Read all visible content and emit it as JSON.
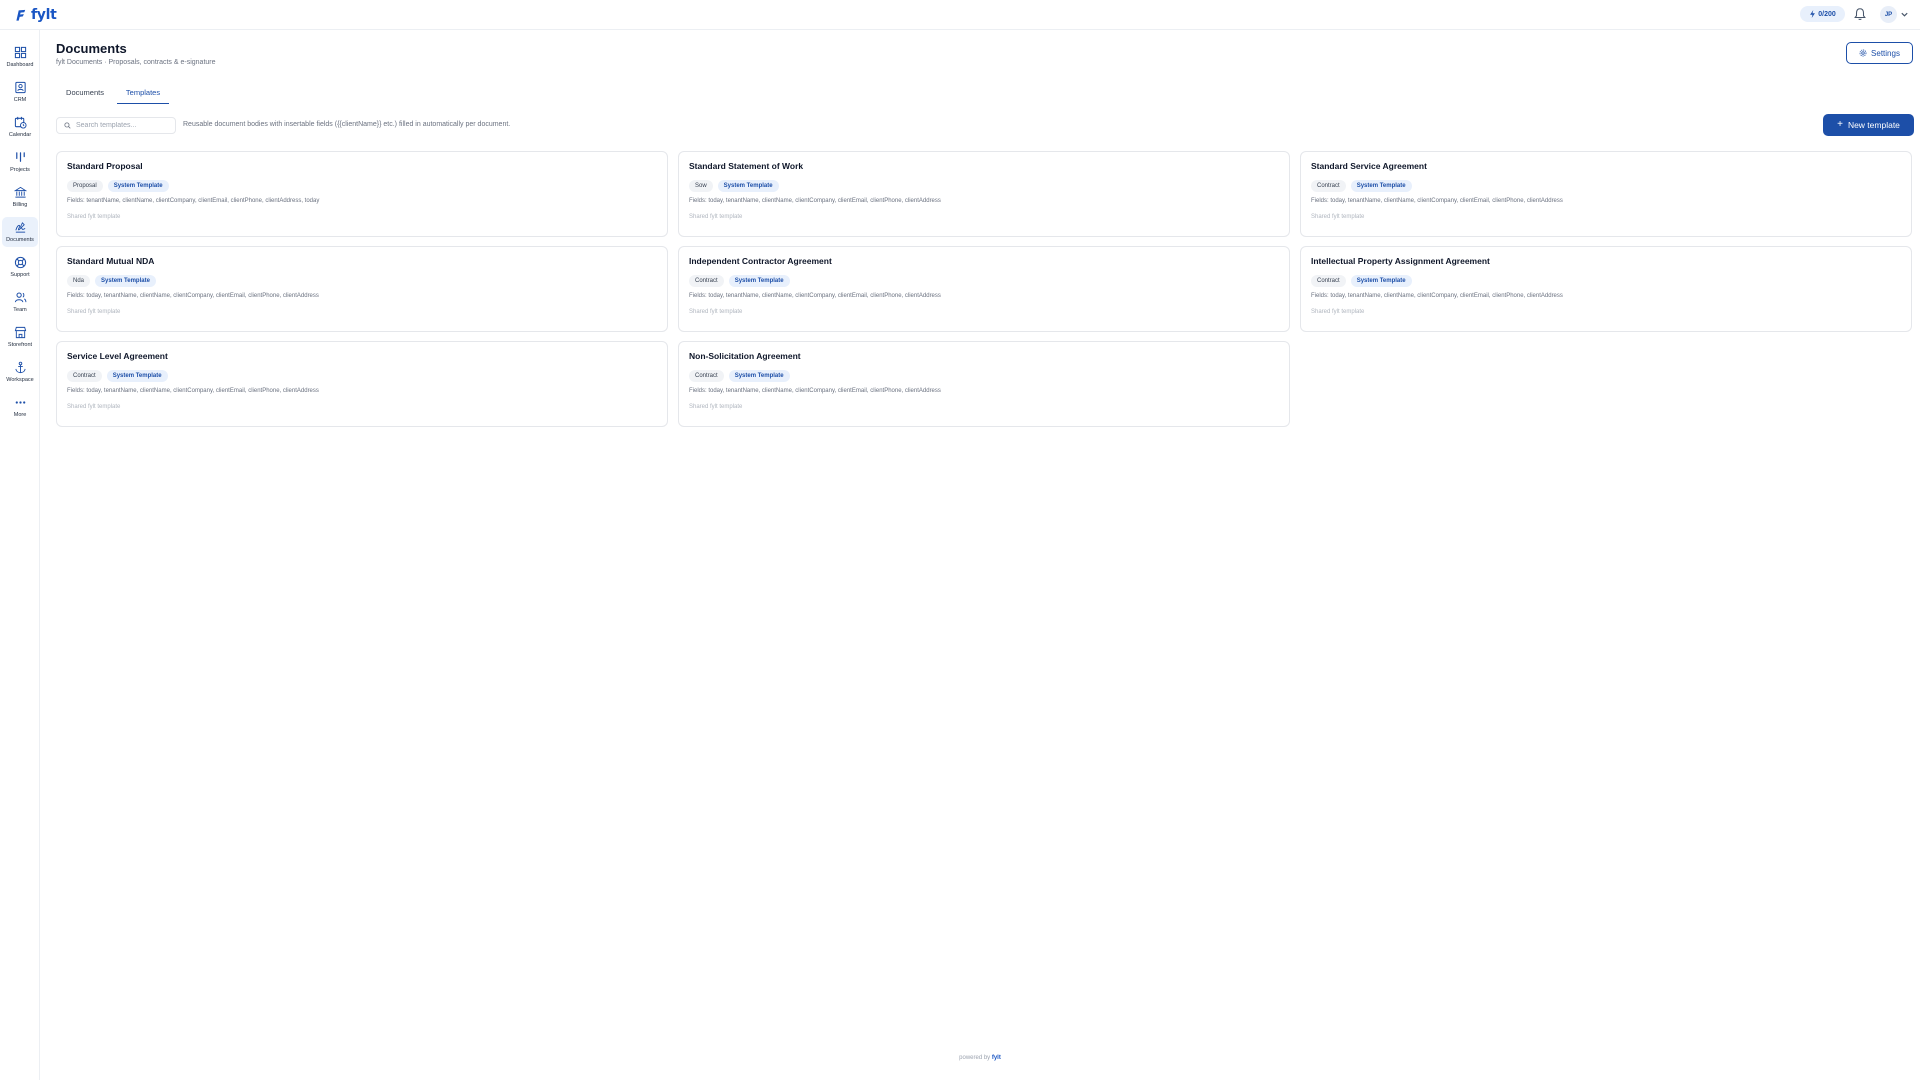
{
  "brand": {
    "name": "fylt"
  },
  "header": {
    "credits": "0/200",
    "avatar_initials": "JP"
  },
  "sidebar": {
    "items": [
      {
        "label": "Dashboard",
        "icon": "grid-icon"
      },
      {
        "label": "CRM",
        "icon": "contact-card-icon"
      },
      {
        "label": "Calendar",
        "icon": "calendar-clock-icon"
      },
      {
        "label": "Projects",
        "icon": "kanban-icon"
      },
      {
        "label": "Billing",
        "icon": "bank-icon"
      },
      {
        "label": "Documents",
        "icon": "signature-icon"
      },
      {
        "label": "Support",
        "icon": "lifebuoy-icon"
      },
      {
        "label": "Team",
        "icon": "users-icon"
      },
      {
        "label": "Storefront",
        "icon": "store-icon"
      },
      {
        "label": "Workspace",
        "icon": "anchor-icon"
      },
      {
        "label": "More",
        "icon": "more-dots-icon"
      }
    ],
    "active": "Documents"
  },
  "page": {
    "title": "Documents",
    "subtitle": "fylt Documents · Proposals, contracts & e-signature",
    "settings_label": "Settings"
  },
  "tabs": [
    {
      "label": "Documents",
      "active": false
    },
    {
      "label": "Templates",
      "active": true
    }
  ],
  "toolbar": {
    "search_placeholder": "Search templates...",
    "hint": "Reusable document bodies with insertable fields ({{clientName}} etc.) filled in automatically per document.",
    "new_template_label": "New template"
  },
  "templates": [
    {
      "title": "Standard Proposal",
      "type": "Proposal",
      "badge": "System Template",
      "fields": "Fields: tenantName, clientName, clientCompany, clientEmail, clientPhone, clientAddress, today",
      "footer": "Shared fylt template"
    },
    {
      "title": "Standard Statement of Work",
      "type": "Sow",
      "badge": "System Template",
      "fields": "Fields: today, tenantName, clientName, clientCompany, clientEmail, clientPhone, clientAddress",
      "footer": "Shared fylt template"
    },
    {
      "title": "Standard Service Agreement",
      "type": "Contract",
      "badge": "System Template",
      "fields": "Fields: today, tenantName, clientName, clientCompany, clientEmail, clientPhone, clientAddress",
      "footer": "Shared fylt template"
    },
    {
      "title": "Standard Mutual NDA",
      "type": "Nda",
      "badge": "System Template",
      "fields": "Fields: today, tenantName, clientName, clientCompany, clientEmail, clientPhone, clientAddress",
      "footer": "Shared fylt template"
    },
    {
      "title": "Independent Contractor Agreement",
      "type": "Contract",
      "badge": "System Template",
      "fields": "Fields: today, tenantName, clientName, clientCompany, clientEmail, clientPhone, clientAddress",
      "footer": "Shared fylt template"
    },
    {
      "title": "Intellectual Property Assignment Agreement",
      "type": "Contract",
      "badge": "System Template",
      "fields": "Fields: today, tenantName, clientName, clientCompany, clientEmail, clientPhone, clientAddress",
      "footer": "Shared fylt template"
    },
    {
      "title": "Service Level Agreement",
      "type": "Contract",
      "badge": "System Template",
      "fields": "Fields: today, tenantName, clientName, clientCompany, clientEmail, clientPhone, clientAddress",
      "footer": "Shared fylt template"
    },
    {
      "title": "Non-Solicitation Agreement",
      "type": "Contract",
      "badge": "System Template",
      "fields": "Fields: today, tenantName, clientName, clientCompany, clientEmail, clientPhone, clientAddress",
      "footer": "Shared fylt template"
    }
  ],
  "footer": {
    "powered_by": "powered by",
    "brand": "fylt"
  },
  "colors": {
    "accent": "#1d4fa8",
    "brand": "#1a56c4",
    "active_nav_bg": "#eaf1fb"
  }
}
